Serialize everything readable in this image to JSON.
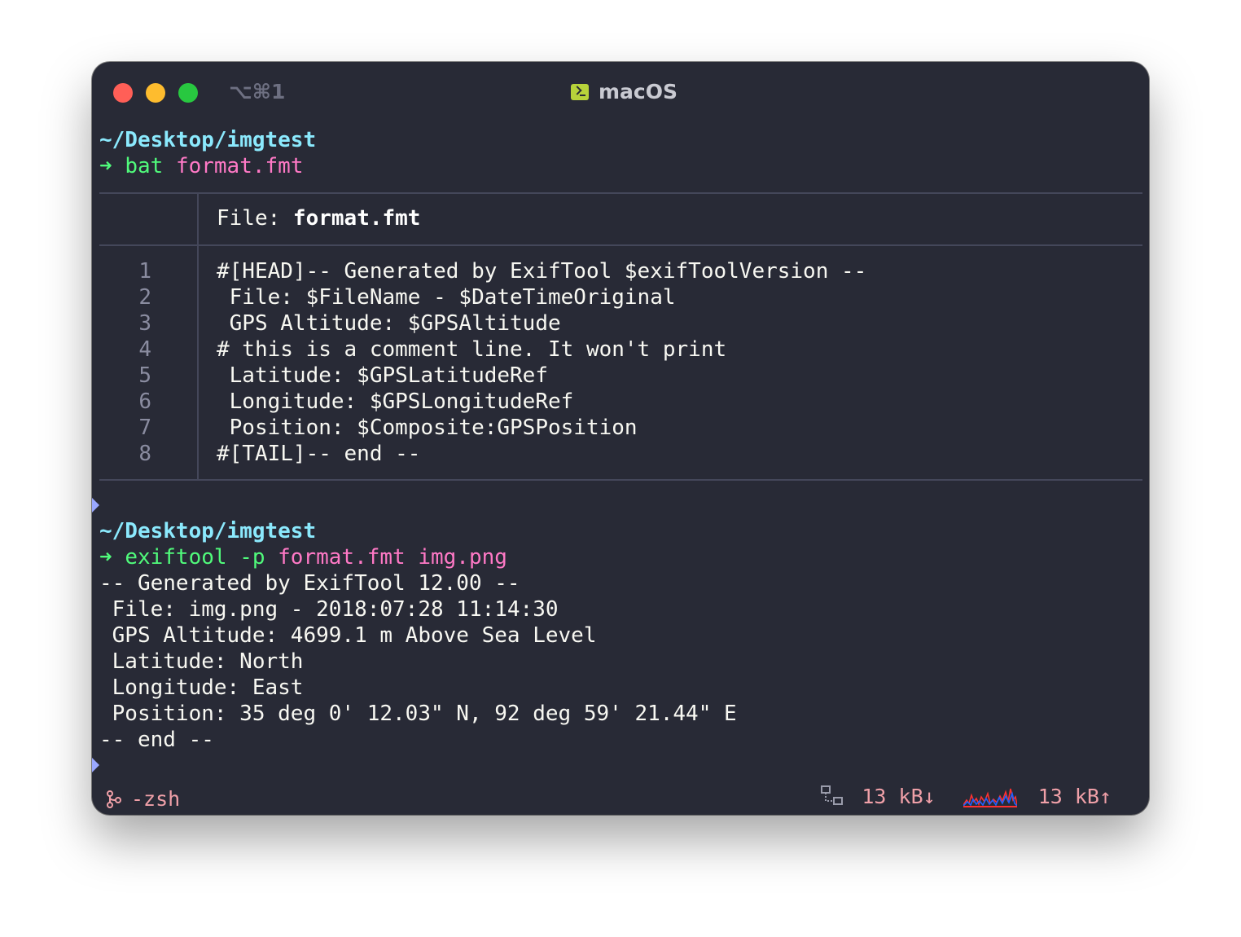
{
  "window": {
    "shortcut": "⌥⌘1",
    "title": "macOS"
  },
  "session1": {
    "cwd": "~/Desktop/imgtest",
    "arrow": "➜",
    "cmd": "bat",
    "arg": "format.fmt"
  },
  "bat": {
    "header_label": "File: ",
    "header_file": "format.fmt",
    "lines": [
      {
        "no": "1",
        "text": "#[HEAD]-- Generated by ExifTool $exifToolVersion --"
      },
      {
        "no": "2",
        "text": " File: $FileName - $DateTimeOriginal"
      },
      {
        "no": "3",
        "text": " GPS Altitude: $GPSAltitude"
      },
      {
        "no": "4",
        "text": "# this is a comment line. It won't print"
      },
      {
        "no": "5",
        "text": " Latitude: $GPSLatitudeRef"
      },
      {
        "no": "6",
        "text": " Longitude: $GPSLongitudeRef"
      },
      {
        "no": "7",
        "text": " Position: $Composite:GPSPosition"
      },
      {
        "no": "8",
        "text": "#[TAIL]-- end --"
      }
    ]
  },
  "session2": {
    "cwd": "~/Desktop/imgtest",
    "arrow": "➜",
    "cmd": "exiftool -p",
    "args": "format.fmt img.png",
    "output": [
      "-- Generated by ExifTool 12.00 --",
      " File: img.png - 2018:07:28 11:14:30",
      " GPS Altitude: 4699.1 m Above Sea Level",
      " Latitude: North",
      " Longitude: East",
      " Position: 35 deg 0' 12.03\" N, 92 deg 59' 21.44\" E",
      "-- end --"
    ]
  },
  "statusbar": {
    "shell": "-zsh",
    "shell_icon": "git-branch-icon",
    "net_icon": "network-icon",
    "download": "13 kB↓",
    "upload": "13 kB↑",
    "colors": {
      "accent_pink": "#f0a0a8",
      "cyan": "#8be9fd",
      "green": "#50fa7b",
      "magenta": "#ff79c6"
    }
  }
}
